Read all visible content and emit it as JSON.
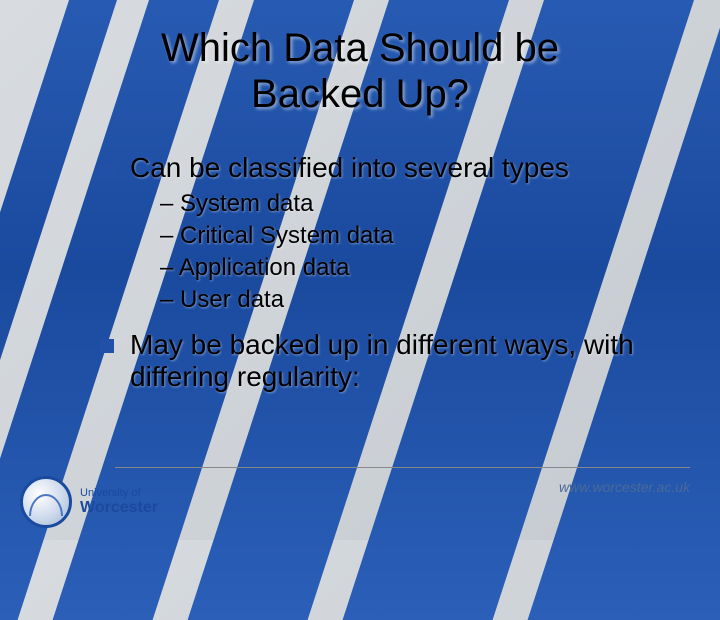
{
  "title_line1": "Which Data Should be",
  "title_line2": "Backed Up?",
  "bullets": {
    "b1": "Can be classified into several types",
    "sub1": "– System data",
    "sub2": "– Critical System data",
    "sub3": "– Application data",
    "sub4": "– User data",
    "b2": "May be backed up in different ways, with differing regularity:"
  },
  "footer": {
    "uni": "University of",
    "worc": "Worcester",
    "url": "www.worcester.ac.uk"
  }
}
